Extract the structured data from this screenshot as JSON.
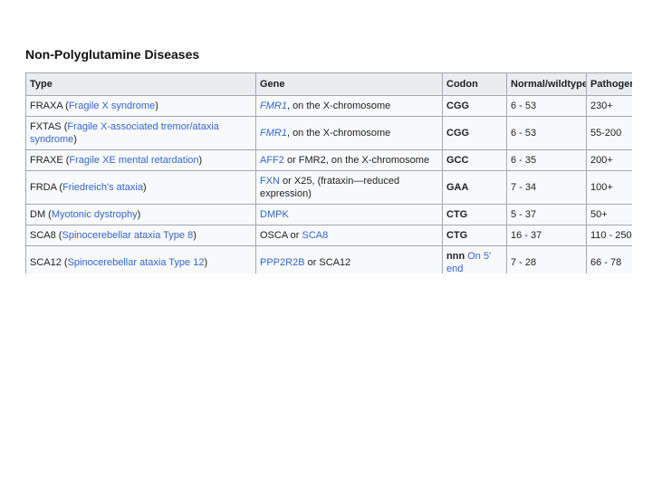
{
  "heading": "Non-Polyglutamine Diseases",
  "table": {
    "headers": [
      "Type",
      "Gene",
      "Codon",
      "Normal/wildtype",
      "Pathogenic"
    ],
    "rows": [
      {
        "type_abbr": "FRAXA",
        "type_paren_open": " (",
        "type_name": "Fragile X syndrome",
        "type_paren_close": ")",
        "gene_link": "FMR1",
        "gene_rest": ", on the X-chromosome",
        "codon": "CGG",
        "normal": "6 - 53",
        "pathogenic": "230+"
      },
      {
        "type_abbr": "FXTAS",
        "type_paren_open": " (",
        "type_name": "Fragile X-associated tremor/ataxia syndrome",
        "type_paren_close": ")",
        "gene_link": "FMR1",
        "gene_rest": ", on the X-chromosome",
        "codon": "CGG",
        "normal": "6 - 53",
        "pathogenic": "55-200"
      },
      {
        "type_abbr": "FRAXE",
        "type_paren_open": " (",
        "type_name": "Fragile XE mental retardation",
        "type_paren_close": ")",
        "gene_link": "AFF2",
        "gene_rest": " or FMR2, on the X-chromosome",
        "codon": "GCC",
        "normal": "6 - 35",
        "pathogenic": "200+"
      },
      {
        "type_abbr": "FRDA",
        "type_paren_open": " (",
        "type_name": "Friedreich's ataxia",
        "type_paren_close": ")",
        "gene_link": "FXN",
        "gene_rest": " or X25, (frataxin—reduced expression)",
        "codon": "GAA",
        "normal": "7 - 34",
        "pathogenic": "100+"
      },
      {
        "type_abbr": "DM",
        "type_paren_open": " (",
        "type_name": "Myotonic dystrophy",
        "type_paren_close": ")",
        "gene_link": "DMPK",
        "gene_rest": "",
        "codon": "CTG",
        "normal": "5 - 37",
        "pathogenic": "50+"
      },
      {
        "type_abbr": "SCA8",
        "type_paren_open": " (",
        "type_name": "Spinocerebellar ataxia Type 8",
        "type_paren_close": ")",
        "gene_link": "OSCA",
        "gene_rest": " or ",
        "gene_link2": "SCA8",
        "codon": "CTG",
        "normal": "16 - 37",
        "pathogenic": "110 - 250"
      },
      {
        "type_abbr": "SCA12",
        "type_paren_open": " (",
        "type_name": "Spinocerebellar ataxia Type 12",
        "type_paren_close": ")",
        "gene_link": "PPP2R2B",
        "gene_rest": " or SCA12",
        "codon": "nnn",
        "codon_link": " On 5' end",
        "normal": "7 - 28",
        "pathogenic": "66 - 78"
      }
    ]
  }
}
